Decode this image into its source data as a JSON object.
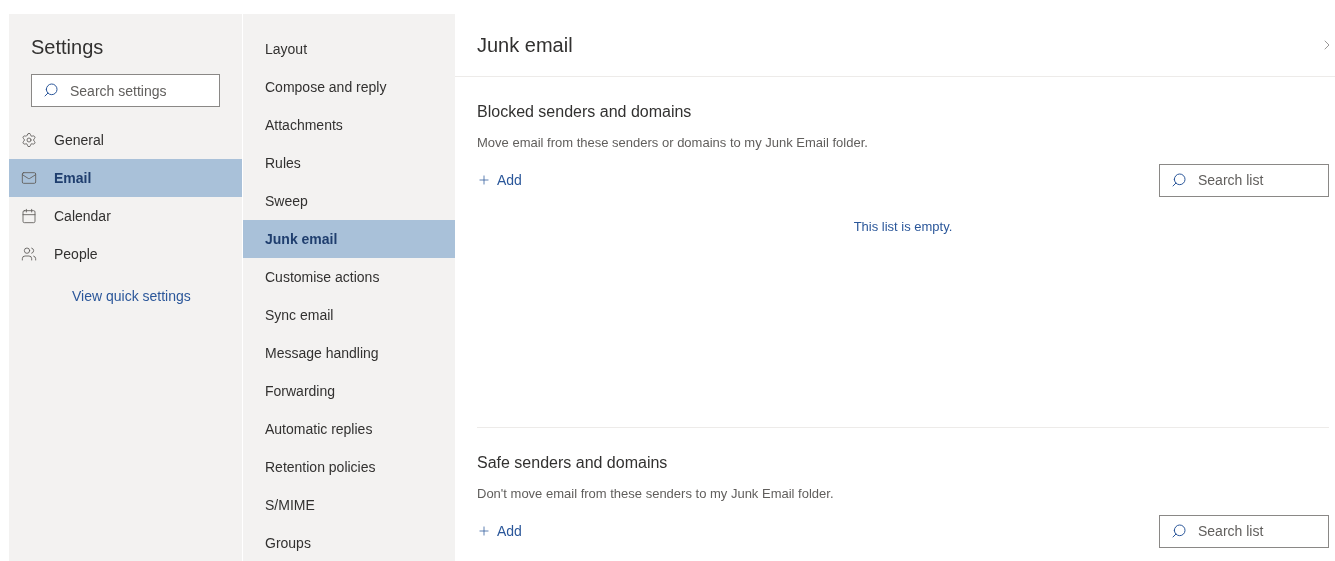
{
  "sidebar": {
    "title": "Settings",
    "search": {
      "placeholder": "Search settings"
    },
    "items": [
      {
        "label": "General",
        "selected": false
      },
      {
        "label": "Email",
        "selected": true
      },
      {
        "label": "Calendar",
        "selected": false
      },
      {
        "label": "People",
        "selected": false
      }
    ],
    "link": "View quick settings"
  },
  "subnav": {
    "items": [
      {
        "label": "Layout",
        "selected": false
      },
      {
        "label": "Compose and reply",
        "selected": false
      },
      {
        "label": "Attachments",
        "selected": false
      },
      {
        "label": "Rules",
        "selected": false
      },
      {
        "label": "Sweep",
        "selected": false
      },
      {
        "label": "Junk email",
        "selected": true
      },
      {
        "label": "Customise actions",
        "selected": false
      },
      {
        "label": "Sync email",
        "selected": false
      },
      {
        "label": "Message handling",
        "selected": false
      },
      {
        "label": "Forwarding",
        "selected": false
      },
      {
        "label": "Automatic replies",
        "selected": false
      },
      {
        "label": "Retention policies",
        "selected": false
      },
      {
        "label": "S/MIME",
        "selected": false
      },
      {
        "label": "Groups",
        "selected": false
      }
    ]
  },
  "panel": {
    "title": "Junk email",
    "sections": [
      {
        "heading": "Blocked senders and domains",
        "description": "Move email from these senders or domains to my Junk Email folder.",
        "add": "Add",
        "search": {
          "placeholder": "Search list"
        },
        "empty": "This list is empty."
      },
      {
        "heading": "Safe senders and domains",
        "description": "Don't move email from these senders to my Junk Email folder.",
        "add": "Add",
        "search": {
          "placeholder": "Search list"
        }
      }
    ]
  }
}
